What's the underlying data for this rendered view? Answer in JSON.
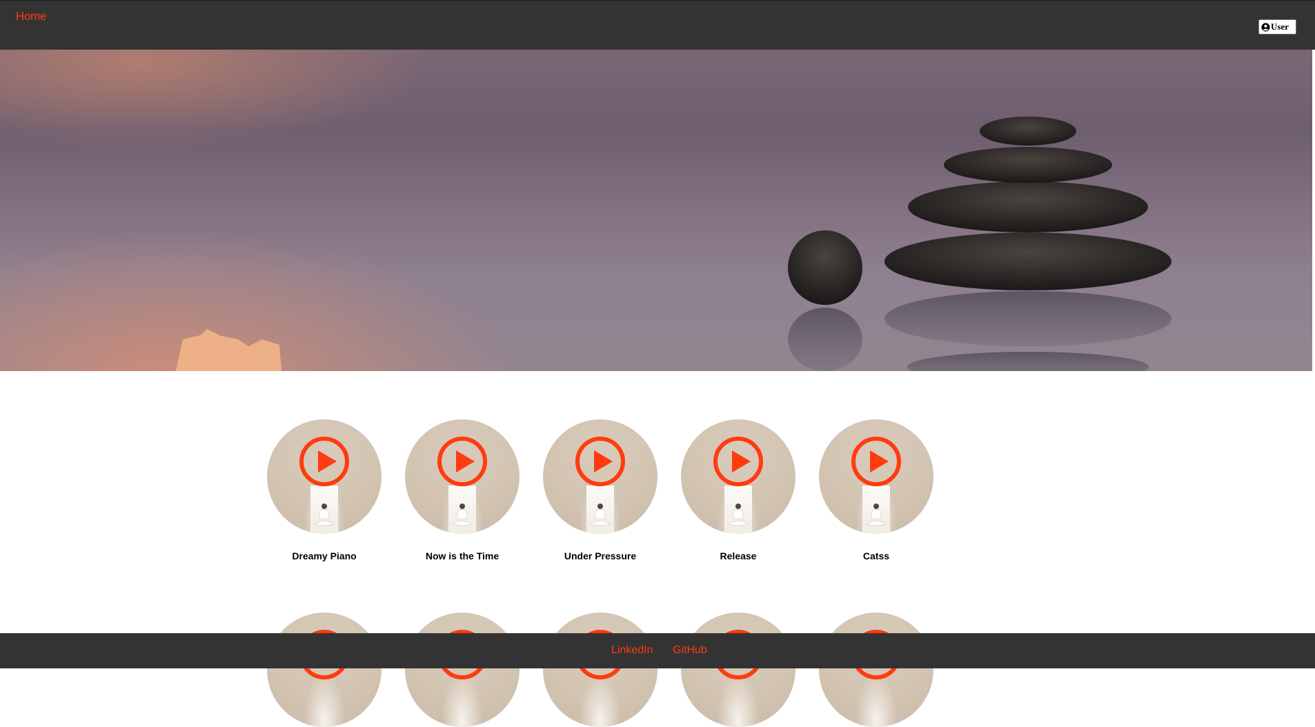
{
  "nav": {
    "home_label": "Home",
    "user_label": "User",
    "user_icon": "user-circle-icon"
  },
  "tracks": [
    {
      "title": "Dreamy Piano"
    },
    {
      "title": "Now is the Time"
    },
    {
      "title": "Under Pressure"
    },
    {
      "title": "Release"
    },
    {
      "title": "Catss"
    }
  ],
  "footer": {
    "linkedin_label": "LinkedIn",
    "github_label": "GitHub"
  },
  "colors": {
    "accent": "#ff3b0f",
    "navbar": "#333333",
    "background": "#ffffff"
  },
  "icons": {
    "play": "play-circle-icon"
  }
}
